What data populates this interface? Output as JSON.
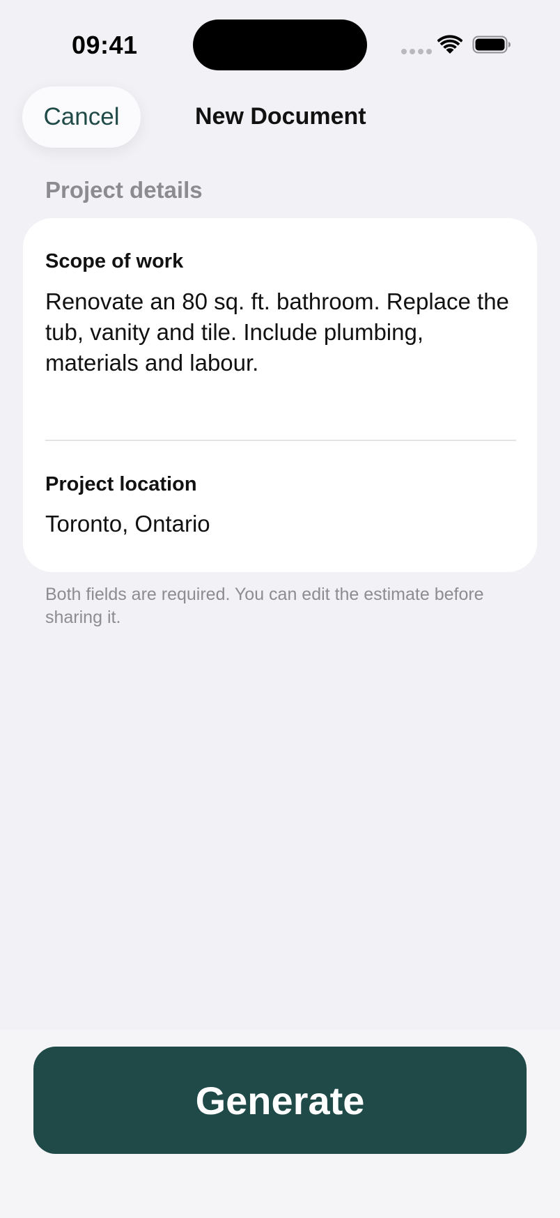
{
  "status_bar": {
    "time": "09:41",
    "icons": [
      "signal-dots-icon",
      "wifi-icon",
      "battery-icon"
    ]
  },
  "nav": {
    "cancel_label": "Cancel",
    "title": "New Document"
  },
  "form": {
    "section_header": "Project details",
    "scope": {
      "label": "Scope of work",
      "value": "Renovate an 80 sq. ft. bathroom. Replace the tub, vanity and tile. Include plumbing, materials and labour."
    },
    "location": {
      "label": "Project location",
      "value": "Toronto, Ontario"
    },
    "footer_note": "Both fields are required. You can edit the estimate before sharing it."
  },
  "actions": {
    "generate_label": "Generate"
  },
  "colors": {
    "accent": "#1f4a48",
    "background": "#f2f2f6",
    "secondary_text": "#8b8b90"
  }
}
